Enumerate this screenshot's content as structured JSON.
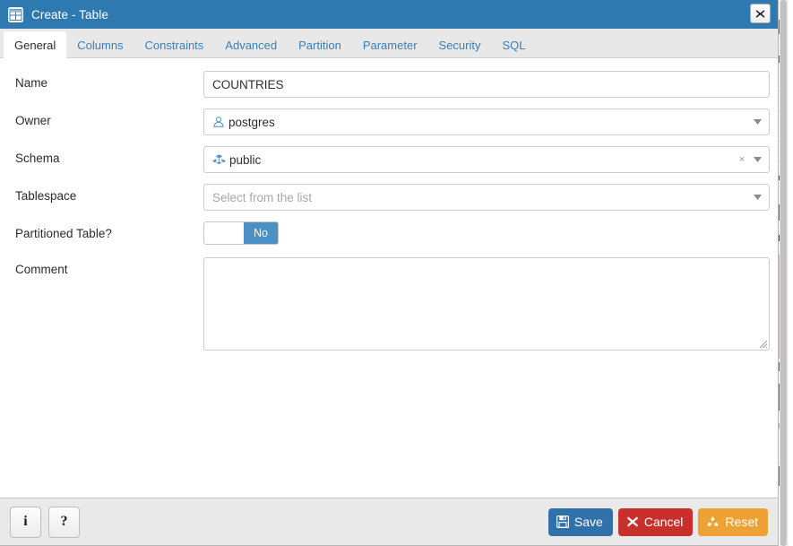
{
  "window": {
    "title": "Create - Table",
    "title_icon": "table-icon",
    "close_icon": "close-icon",
    "close_label": "Close"
  },
  "tabs": [
    {
      "label": "General",
      "active": true
    },
    {
      "label": "Columns",
      "active": false
    },
    {
      "label": "Constraints",
      "active": false
    },
    {
      "label": "Advanced",
      "active": false
    },
    {
      "label": "Partition",
      "active": false
    },
    {
      "label": "Parameter",
      "active": false
    },
    {
      "label": "Security",
      "active": false
    },
    {
      "label": "SQL",
      "active": false
    }
  ],
  "form": {
    "name": {
      "label": "Name",
      "value": "COUNTRIES",
      "placeholder": ""
    },
    "owner": {
      "label": "Owner",
      "value": "postgres",
      "icon": "user-icon",
      "caret": "chevron-down-icon"
    },
    "schema": {
      "label": "Schema",
      "value": "public",
      "icon": "schema-icon",
      "clear_label": "×",
      "caret": "chevron-down-icon"
    },
    "tablespace": {
      "label": "Tablespace",
      "value": "",
      "placeholder": "Select from the list",
      "caret": "chevron-down-icon"
    },
    "partitioned": {
      "label": "Partitioned Table?",
      "state_label": "No",
      "state": false
    },
    "comment": {
      "label": "Comment",
      "value": "",
      "placeholder": ""
    }
  },
  "footer": {
    "info_label": "i",
    "info_name": "info-icon",
    "help_label": "?",
    "help_name": "help-icon",
    "save_label": "Save",
    "cancel_label": "Cancel",
    "reset_label": "Reset"
  },
  "colors": {
    "titlebar_blue": "#2e7ab0",
    "accent_blue": "#3071a9",
    "link_blue": "#3b7fb5",
    "toggle_blue": "#4a90c4",
    "danger_red": "#c9302c",
    "warning_orange": "#eea236",
    "tabbar_grey": "#e8e8e8",
    "footer_grey": "#e9e9e9",
    "border_grey": "#cccccc"
  }
}
